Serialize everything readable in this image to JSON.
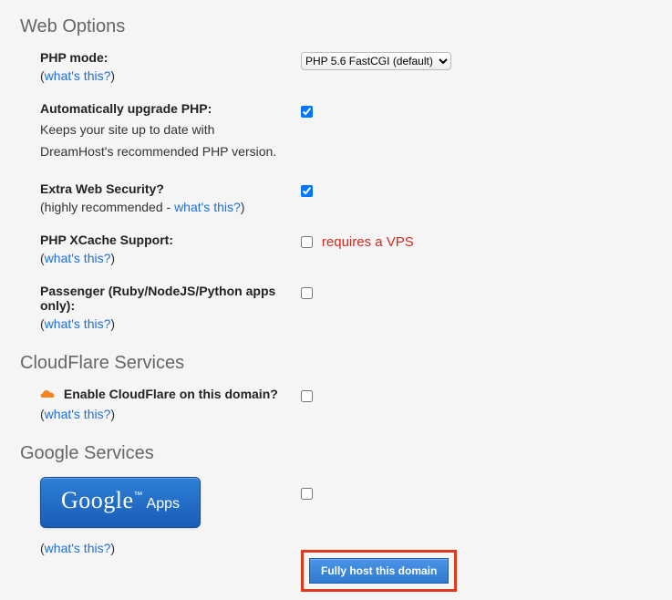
{
  "sections": {
    "web": {
      "title": "Web Options",
      "phpMode": {
        "label": "PHP mode:",
        "whatsThis": "what's this?",
        "selected": "PHP 5.6 FastCGI (default)"
      },
      "autoUpgrade": {
        "label": "Automatically upgrade PHP:",
        "desc": "Keeps your site up to date with DreamHost's recommended PHP version.",
        "checked": true
      },
      "extraSecurity": {
        "label": "Extra Web Security?",
        "hintPrefix": "(highly recommended - ",
        "whatsThis": "what's this?",
        "hintSuffix": ")",
        "checked": true
      },
      "xcache": {
        "label": "PHP XCache Support:",
        "whatsThis": "what's this?",
        "note": "requires a VPS",
        "checked": false
      },
      "passenger": {
        "label": "Passenger (Ruby/NodeJS/Python apps only):",
        "whatsThis": "what's this?",
        "checked": false
      }
    },
    "cloudflare": {
      "title": "CloudFlare Services",
      "enable": {
        "label": "Enable CloudFlare on this domain?",
        "whatsThis": "what's this?",
        "checked": false
      }
    },
    "google": {
      "title": "Google Services",
      "apps": {
        "brandMain": "Google",
        "brandSub": "Apps",
        "whatsThis": "what's this?",
        "checked": false
      }
    }
  },
  "submit": "Fully host this domain"
}
